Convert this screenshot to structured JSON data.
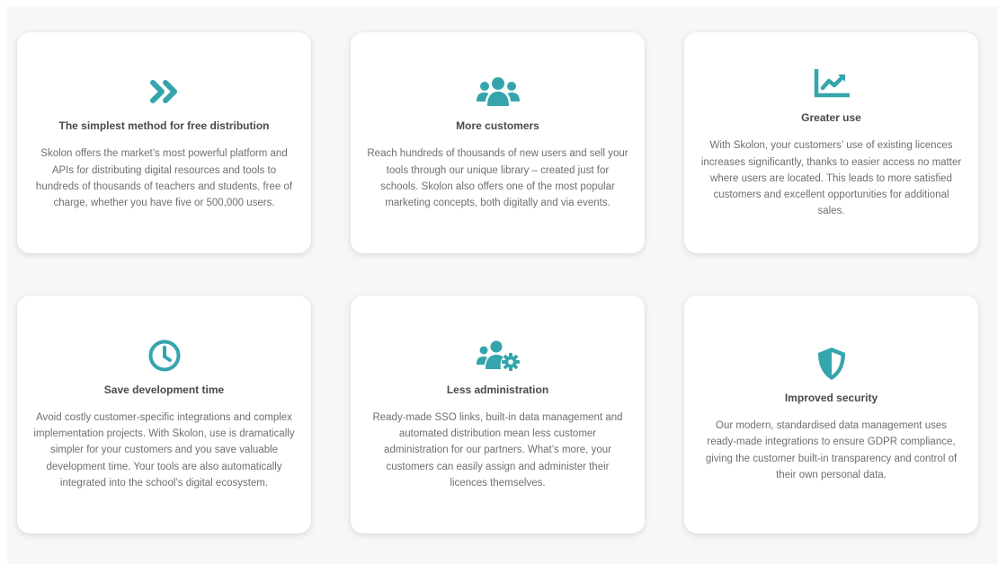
{
  "accent_color": "#34a5ac",
  "cards": [
    {
      "icon": "double-chevron-right-icon",
      "title": "The simplest method for free distribution",
      "body": "Skolon offers the market’s most powerful platform and APIs for distributing digital resources and tools to hundreds of thousands of teachers and students, free of charge, whether you have five or 500,000 users."
    },
    {
      "icon": "users-group-icon",
      "title": "More customers",
      "body": "Reach hundreds of thousands of new users and sell your tools through our unique library – created just for schools. Skolon also offers one of the most popular marketing concepts, both digitally and via events."
    },
    {
      "icon": "chart-line-icon",
      "title": "Greater use",
      "body": "With Skolon, your customers’ use of existing licences increases significantly, thanks to easier access no matter where users are located. This leads to more satisfied customers and excellent opportunities for additional sales."
    },
    {
      "icon": "clock-icon",
      "title": "Save development time",
      "body": "Avoid costly customer-specific integrations and complex implementation projects. With Skolon, use is dramatically simpler for your customers and you save valuable development time. Your tools are also automatically integrated into the school’s digital ecosystem."
    },
    {
      "icon": "users-cog-icon",
      "title": "Less administration",
      "body": "Ready-made SSO links, built-in data management and automated distribution mean less customer administration for our partners. What’s more, your customers can easily assign and administer their licences themselves."
    },
    {
      "icon": "shield-icon",
      "title": "Improved security",
      "body": "Our modern, standardised data management uses ready-made integrations to ensure GDPR compliance, giving the customer built-in transparency and control of their own personal data."
    }
  ]
}
